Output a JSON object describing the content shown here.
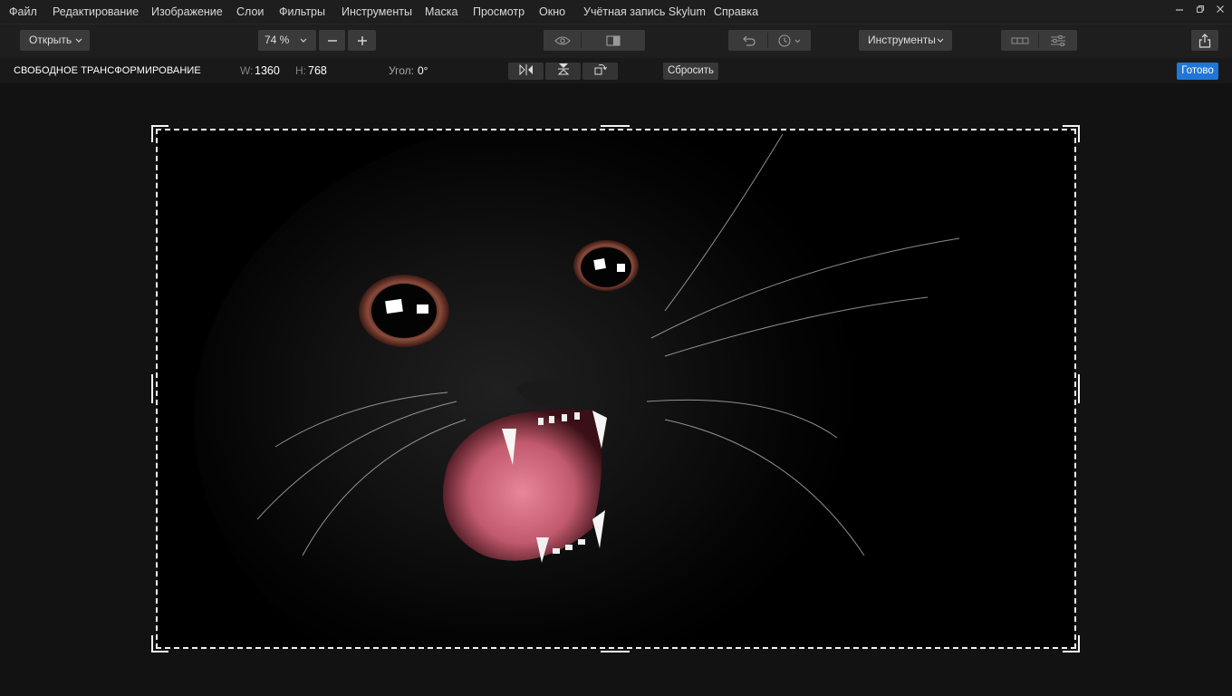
{
  "menu": {
    "items": [
      "Файл",
      "Редактирование",
      "Изображение",
      "Слои",
      "Фильтры",
      "Инструменты",
      "Маска",
      "Просмотр",
      "Окно",
      "Учётная запись Skylum",
      "Справка"
    ]
  },
  "toolbar": {
    "open_label": "Открыть",
    "zoom_value": "74 %",
    "tools_label": "Инструменты"
  },
  "options": {
    "title": "СВОБОДНОЕ ТРАНСФОРМИРОВАНИЕ",
    "width_key": "W:",
    "width_value": "1360",
    "height_key": "H:",
    "height_value": "768",
    "angle_key": "Угол:",
    "angle_value": "0°",
    "reset_label": "Сбросить",
    "done_label": "Готово"
  },
  "colors": {
    "accent": "#1f76d9",
    "background": "#121212",
    "bar": "#1e1e1e"
  },
  "icons": {
    "window": [
      "minimize-icon",
      "restore-icon",
      "close-icon"
    ],
    "toolbar": [
      "minus-icon",
      "plus-icon",
      "eye-icon",
      "compare-icon",
      "undo-icon",
      "history-icon",
      "layers-icon",
      "adjustments-icon",
      "share-icon"
    ],
    "options": [
      "flip-horizontal-icon",
      "flip-vertical-icon",
      "rotate-icon"
    ]
  }
}
